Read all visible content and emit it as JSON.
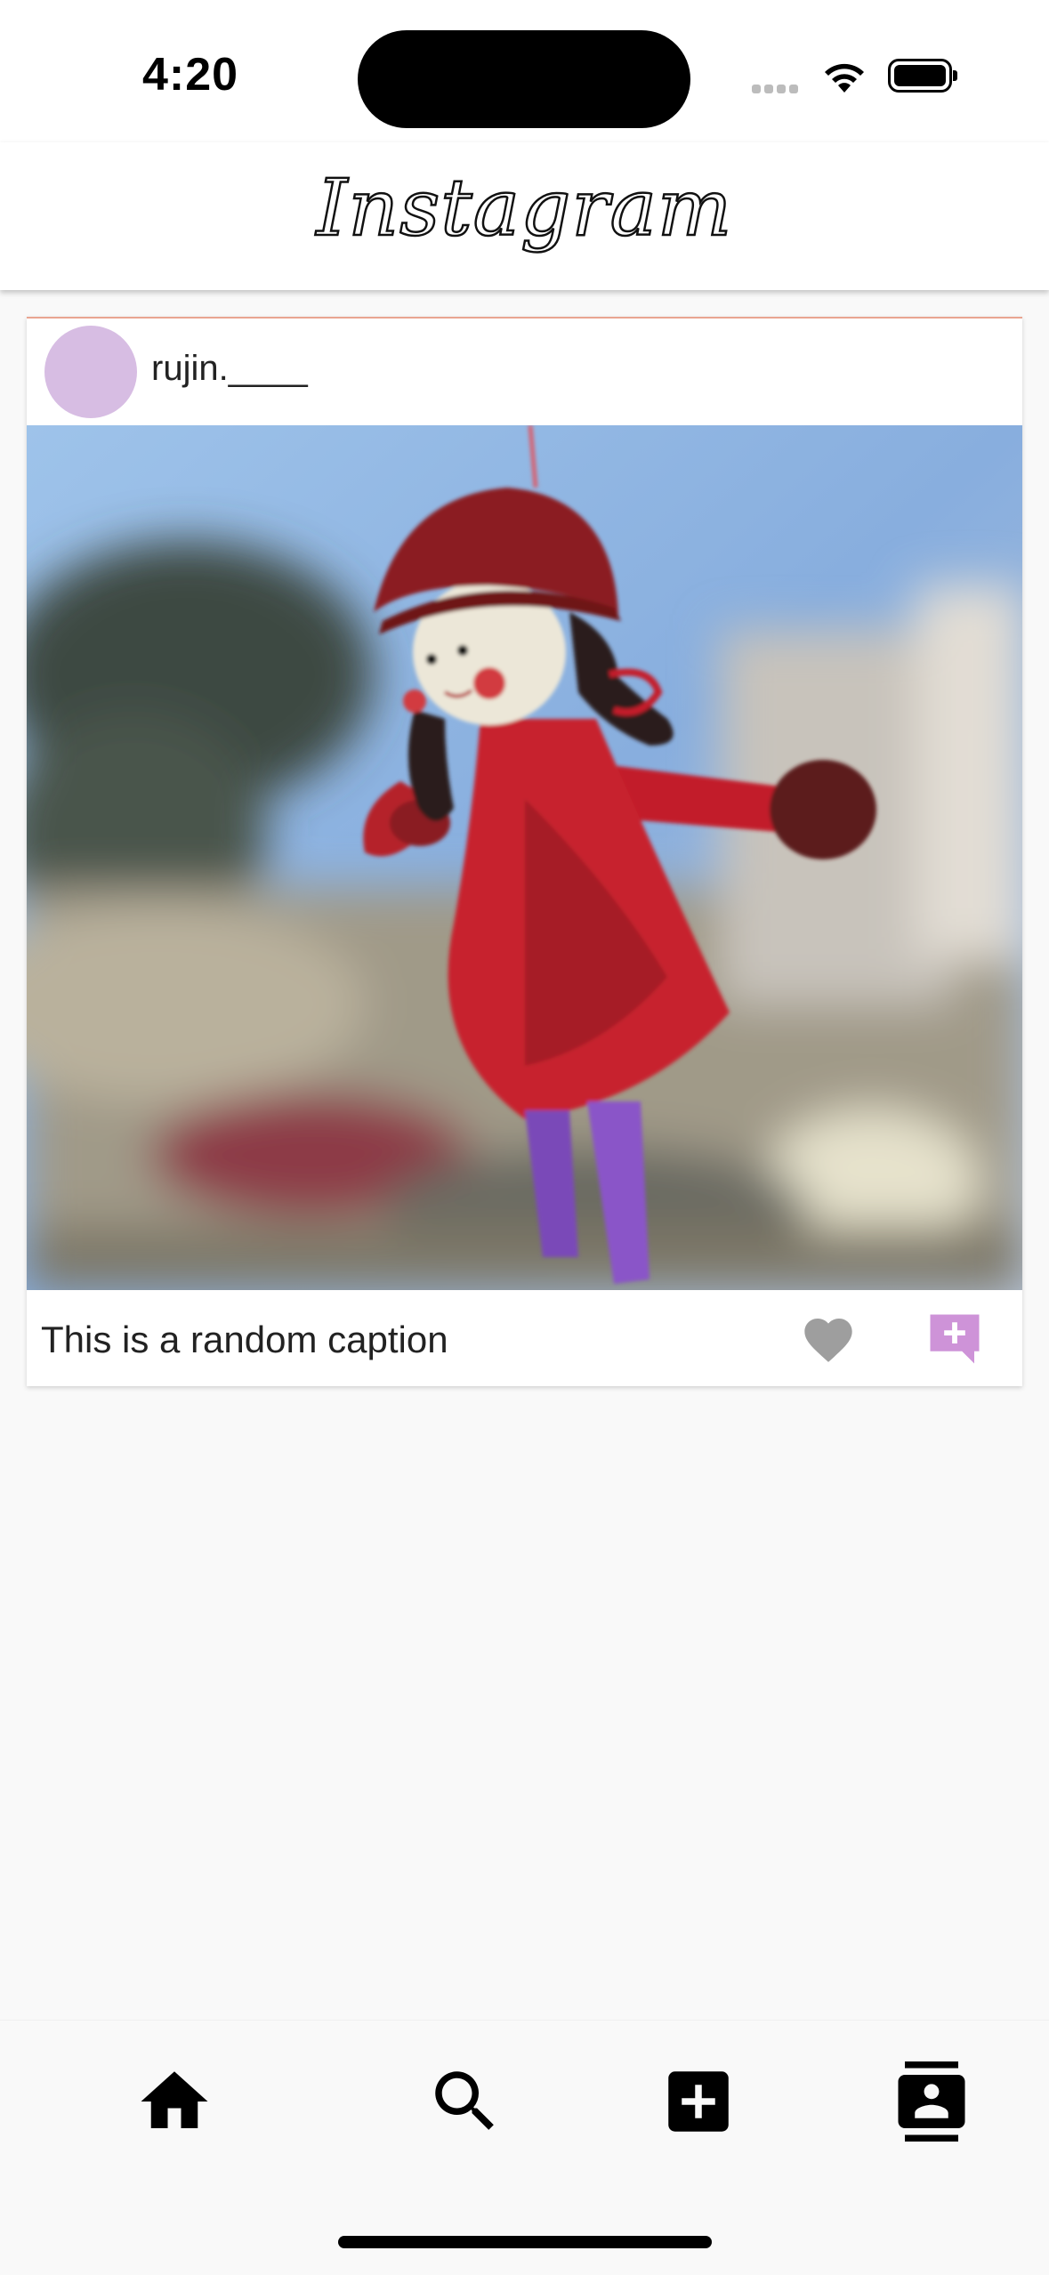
{
  "status_bar": {
    "time": "4:20",
    "icons": [
      "cellular-signal-icon",
      "wifi-icon",
      "battery-icon"
    ]
  },
  "app_bar": {
    "title": "Instagram"
  },
  "post": {
    "username": "rujin.____",
    "caption": "This is a random caption",
    "avatar_color": "#d7bde3",
    "image_description_icon": "photo",
    "actions": [
      "heart-icon",
      "add-comment-icon"
    ],
    "like_color": "#9e9e9e",
    "comment_color": "#ce93d8"
  },
  "bottom_nav": {
    "items": [
      "home-icon",
      "search-icon",
      "add-post-icon",
      "profile-icon"
    ]
  }
}
